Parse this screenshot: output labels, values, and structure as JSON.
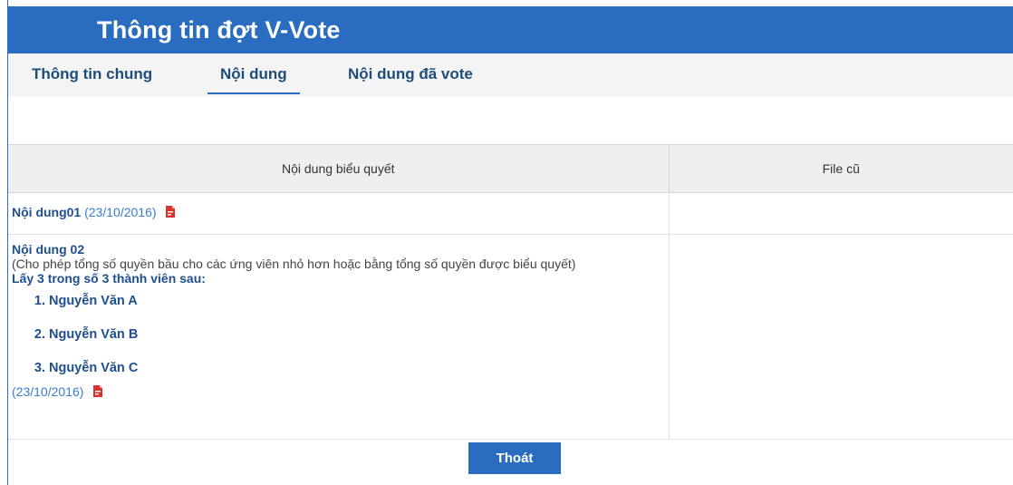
{
  "header": {
    "title": "Thông tin đợt V-Vote"
  },
  "tabs": [
    {
      "label": "Thông tin chung",
      "active": false
    },
    {
      "label": "Nội dung",
      "active": true
    },
    {
      "label": "Nội dung đã vote",
      "active": false
    }
  ],
  "table": {
    "columns": [
      "Nội dung biểu quyết",
      "File cũ"
    ],
    "rows": [
      {
        "title": "Nội dung01",
        "date": "(23/10/2016)",
        "file_icon": "pdf-icon"
      },
      {
        "title": "Nội dung 02",
        "note": "(Cho phép tổng số quyền bầu cho các ứng viên nhỏ hơn hoặc bằng tổng số quyền được biểu quyết)",
        "instruction": "Lấy 3 trong số 3 thành viên sau:",
        "candidates": [
          "Nguyễn Văn A",
          "Nguyễn Văn B",
          "Nguyễn Văn C"
        ],
        "date": "(23/10/2016)",
        "file_icon": "pdf-icon"
      }
    ]
  },
  "buttons": {
    "exit_label": "Thoát"
  },
  "colors": {
    "brand_blue": "#2a6cbf",
    "link_blue": "#1f4f8f",
    "date_blue": "#3a7dd1",
    "pdf_red": "#d9322f"
  }
}
